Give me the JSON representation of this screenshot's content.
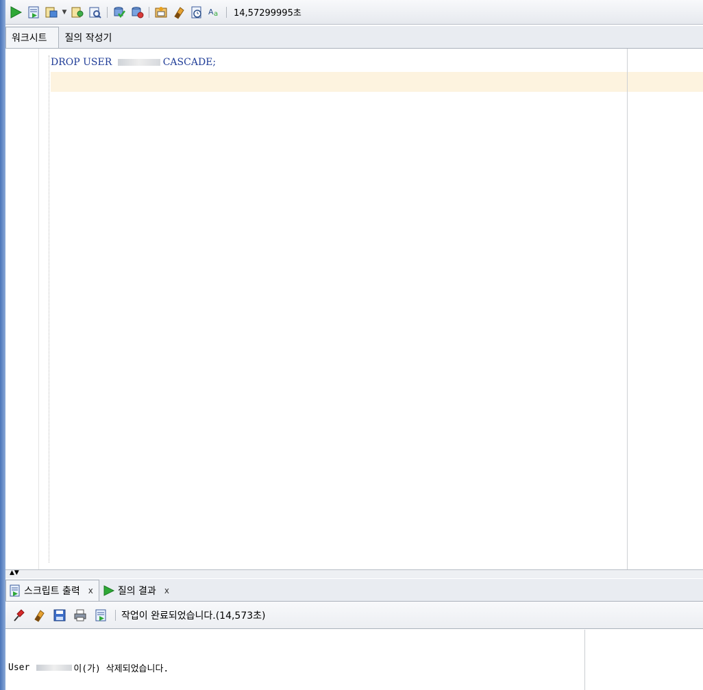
{
  "toolbar": {
    "timing": "14,57299995초",
    "icons": [
      "run-statement-icon",
      "run-script-icon",
      "autotrace-icon",
      "dropdown-arrow-icon",
      "explain-plan-icon",
      "sql-tuning-icon",
      "commit-icon",
      "rollback-icon",
      "unshared-sql-icon",
      "clear-icon",
      "sql-history-icon",
      "format-icon"
    ]
  },
  "subtabs": {
    "worksheet": "워크시트",
    "query_builder": "질의 작성기"
  },
  "editor": {
    "sql_before": "DROP USER ",
    "sql_after": "CASCADE;"
  },
  "bottom_tabs": {
    "script_output": "스크립트 출력",
    "query_result": "질의 결과",
    "close": "x"
  },
  "output_toolbar": {
    "status": "작업이 완료되었습니다.(14,573초)"
  },
  "output": {
    "prefix": "User",
    "suffix": "이(가) 삭제되었습니다."
  },
  "colors": {
    "run_green": "#2ea836",
    "sql_keyword": "#1f3c97",
    "current_line": "#fdf3df"
  }
}
